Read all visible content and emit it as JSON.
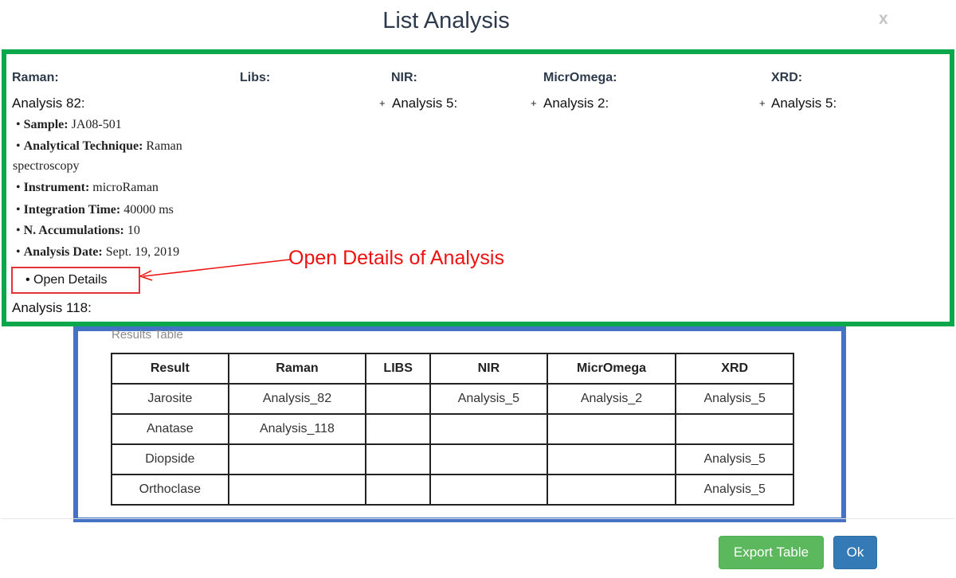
{
  "modal": {
    "title": "List Analysis",
    "close": "x"
  },
  "columns": {
    "raman": {
      "header": "Raman:",
      "items": [
        "Analysis 82:",
        "Analysis 118:"
      ]
    },
    "libs": {
      "header": "Libs:"
    },
    "nir": {
      "header": "NIR:",
      "item": "Analysis 5:"
    },
    "micromega": {
      "header": "MicrOmega:",
      "item": "Analysis 2:"
    },
    "xrd": {
      "header": "XRD:",
      "item": "Analysis 5:"
    }
  },
  "expand_symbol": "+",
  "details": [
    {
      "label": "Sample:",
      "value": "JA08-501"
    },
    {
      "label": "Analytical Technique:",
      "value": "Raman"
    },
    {
      "label": "",
      "value": "spectroscopy"
    },
    {
      "label": "Instrument:",
      "value": "microRaman"
    },
    {
      "label": "Integration Time:",
      "value": "40000 ms"
    },
    {
      "label": "N. Accumulations:",
      "value": "10"
    },
    {
      "label": "Analysis Date:",
      "value": "Sept. 19, 2019"
    }
  ],
  "open_details": "• Open Details",
  "annotation": "Open Details of Analysis",
  "results": {
    "caption": "Results Table",
    "headers": [
      "Result",
      "Raman",
      "LIBS",
      "NIR",
      "MicrOmega",
      "XRD"
    ],
    "rows": [
      [
        "Jarosite",
        "Analysis_82",
        "",
        "Analysis_5",
        "Analysis_2",
        "Analysis_5"
      ],
      [
        "Anatase",
        "Analysis_118",
        "",
        "",
        "",
        ""
      ],
      [
        "Diopside",
        "",
        "",
        "",
        "",
        "Analysis_5"
      ],
      [
        "Orthoclase",
        "",
        "",
        "",
        "",
        "Analysis_5"
      ]
    ]
  },
  "buttons": {
    "export": "Export Table",
    "ok": "Ok"
  },
  "colors": {
    "green_box": "#0aa84a",
    "blue_box": "#4472c4",
    "annotation": "#ee1111",
    "export_btn": "#5cb85c",
    "ok_btn": "#337ab7"
  }
}
